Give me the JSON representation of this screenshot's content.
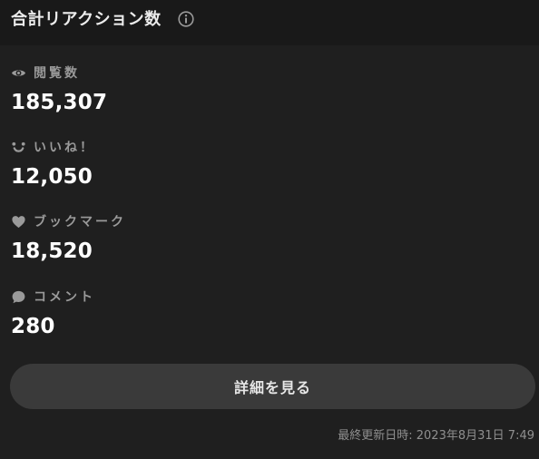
{
  "header": {
    "title": "合計リアクション数",
    "info_icon": "info-circle-icon"
  },
  "stats": [
    {
      "icon": "eye-icon",
      "label": "閲覧数",
      "value": "185,307"
    },
    {
      "icon": "smile-icon",
      "label": "いいね！",
      "value": "12,050"
    },
    {
      "icon": "heart-icon",
      "label": "ブックマーク",
      "value": "18,520"
    },
    {
      "icon": "speech-bubble-icon",
      "label": "コメント",
      "value": "280"
    }
  ],
  "button": {
    "label": "詳細を見る"
  },
  "footer": {
    "last_updated": "最終更新日時: 2023年8月31日 7:49"
  },
  "colors": {
    "background": "#1f1f1f",
    "header_background": "#191919",
    "button_background": "#3a3a3a",
    "label_gray": "#9a9a9a"
  }
}
